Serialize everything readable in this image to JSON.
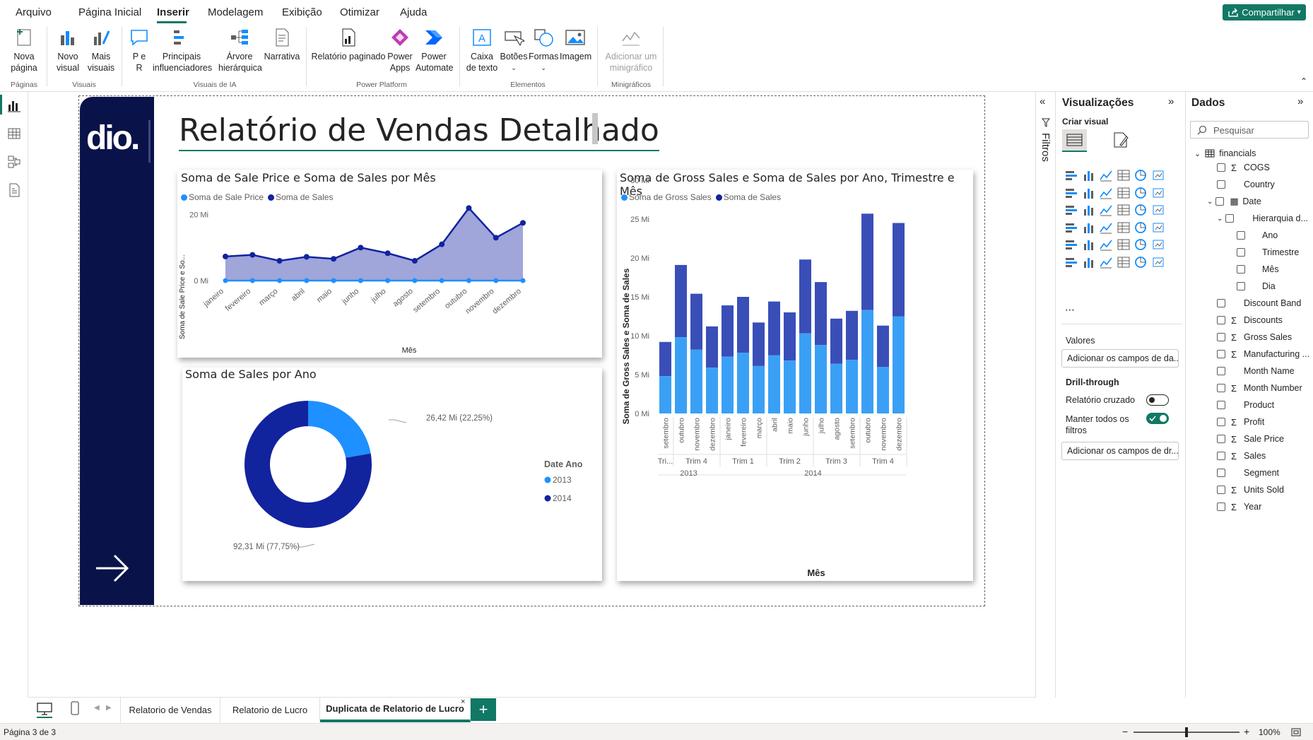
{
  "menu": {
    "items": [
      "Arquivo",
      "Página Inicial",
      "Inserir",
      "Modelagem",
      "Exibição",
      "Otimizar",
      "Ajuda"
    ],
    "active": "Inserir",
    "share_label": "Compartilhar"
  },
  "ribbon": {
    "paginas": {
      "label": "Páginas",
      "new_page": "Nova página"
    },
    "visuais": {
      "label": "Visuais",
      "new_visual": "Novo visual",
      "more_visuals": "Mais visuais"
    },
    "ia": {
      "label": "Visuais de IA",
      "qa": "P e R",
      "key_influencers": "Principais influenciadores",
      "decomp_tree": "Árvore hierárquica",
      "narrative": "Narrativa"
    },
    "power_platform": {
      "label": "Power Platform",
      "paginated": "Relatório paginado",
      "power_apps": "Power Apps",
      "power_automate": "Power Automate"
    },
    "elementos": {
      "label": "Elementos",
      "textbox": "Caixa de texto",
      "buttons": "Botões",
      "shapes": "Formas",
      "image": "Imagem"
    },
    "minigraficos": {
      "label": "Minigráficos",
      "add_sparkline": "Adicionar um minigráfico"
    }
  },
  "report": {
    "title": "Relatório de Vendas Detalhado",
    "logo_text": "dio."
  },
  "charts": {
    "line": {
      "title": "Soma de Sale Price e Soma de Sales por Mês",
      "legend": [
        "Soma de Sale Price",
        "Soma de Sales"
      ],
      "ylabel": "Soma de Sale Price e So...",
      "xlabel": "Mês",
      "yticks": [
        "20 Mi",
        "0 Mi"
      ]
    },
    "donut": {
      "title": "Soma de Sales por Ano",
      "legend_title": "Date Ano",
      "legend": [
        "2013",
        "2014"
      ],
      "label_2013": "26,42 Mi (22,25%)",
      "label_2014": "92,31 Mi (77,75%)"
    },
    "bar": {
      "title": "Soma de Gross Sales e Soma de Sales por Ano, Trimestre e Mês",
      "legend": [
        "Soma de Gross Sales",
        "Soma de Sales"
      ],
      "ylabel": "Soma de Gross Sales e Soma de Sales",
      "xlabel": "Mês",
      "yticks": [
        "30 Mi",
        "25 Mi",
        "20 Mi",
        "15 Mi",
        "10 Mi",
        "5 Mi",
        "0 Mi"
      ]
    }
  },
  "chart_data": [
    {
      "type": "area",
      "title": "Soma de Sale Price e Soma de Sales por Mês",
      "xlabel": "Mês",
      "ylabel": "Soma de Sale Price e So...",
      "categories": [
        "janeiro",
        "fevereiro",
        "março",
        "abril",
        "maio",
        "junho",
        "julho",
        "agosto",
        "setembro",
        "outubro",
        "novembro",
        "dezembro"
      ],
      "ylim": [
        0,
        24
      ],
      "series": [
        {
          "name": "Soma de Sale Price",
          "values": [
            0,
            0,
            0,
            0,
            0,
            0,
            0,
            0,
            0,
            0,
            0,
            0
          ]
        },
        {
          "name": "Soma de Sales",
          "values": [
            7.3,
            7.8,
            6.0,
            7.2,
            6.6,
            10.0,
            8.3,
            6.0,
            11.0,
            22.0,
            13.0,
            17.5
          ]
        }
      ]
    },
    {
      "type": "pie",
      "title": "Soma de Sales por Ano",
      "categories": [
        "2013",
        "2014"
      ],
      "values": [
        26.42,
        92.31
      ],
      "percent": [
        22.25,
        77.75
      ]
    },
    {
      "type": "bar",
      "title": "Soma de Gross Sales e Soma de Sales por Ano, Trimestre e Mês",
      "xlabel": "Mês",
      "ylabel": "Soma de Gross Sales e Soma de Sales",
      "ylim": [
        0,
        30
      ],
      "categories": [
        "setembro",
        "outubro",
        "novembro",
        "dezembro",
        "janeiro",
        "fevereiro",
        "março",
        "abril",
        "maio",
        "junho",
        "julho",
        "agosto",
        "setembro",
        "outubro",
        "novembro",
        "dezembro"
      ],
      "quarters": [
        "Tri...",
        "Trim 4",
        "Trim 1",
        "Trim 2",
        "Trim 3",
        "Trim 4"
      ],
      "years": [
        "2013",
        "2014"
      ],
      "series": [
        {
          "name": "Soma de Sales",
          "values": [
            4.8,
            9.8,
            8.2,
            5.9,
            7.3,
            7.8,
            6.1,
            7.5,
            6.8,
            10.3,
            8.8,
            6.4,
            6.9,
            13.3,
            6.0,
            12.5
          ]
        },
        {
          "name": "Soma de Gross Sales",
          "values": [
            9.2,
            19.1,
            15.4,
            11.2,
            13.9,
            15.0,
            11.7,
            14.4,
            13.0,
            19.8,
            16.9,
            12.2,
            13.2,
            25.7,
            11.3,
            24.5
          ]
        }
      ]
    }
  ],
  "filters_label": "Filtros",
  "visualizations": {
    "title": "Visualizações",
    "create_label": "Criar visual",
    "values_label": "Valores",
    "values_placeholder": "Adicionar os campos de da...",
    "drill_label": "Drill-through",
    "cross_report": "Relatório cruzado",
    "keep_filters": "Manter todos os filtros",
    "drill_placeholder": "Adicionar os campos de dr..."
  },
  "data_pane": {
    "title": "Dados",
    "search_placeholder": "Pesquisar",
    "table": "financials",
    "fields": [
      {
        "name": "COGS",
        "sigma": true,
        "level": 1
      },
      {
        "name": "Country",
        "sigma": false,
        "level": 1
      },
      {
        "name": "Date",
        "sigma": false,
        "level": 1,
        "expandable": true
      },
      {
        "name": "Hierarquia d...",
        "sigma": false,
        "level": 2,
        "expandable": true
      },
      {
        "name": "Ano",
        "sigma": false,
        "level": 3
      },
      {
        "name": "Trimestre",
        "sigma": false,
        "level": 3
      },
      {
        "name": "Mês",
        "sigma": false,
        "level": 3
      },
      {
        "name": "Dia",
        "sigma": false,
        "level": 3
      },
      {
        "name": "Discount Band",
        "sigma": false,
        "level": 1
      },
      {
        "name": "Discounts",
        "sigma": true,
        "level": 1
      },
      {
        "name": "Gross Sales",
        "sigma": true,
        "level": 1
      },
      {
        "name": "Manufacturing ...",
        "sigma": true,
        "level": 1
      },
      {
        "name": "Month Name",
        "sigma": false,
        "level": 1
      },
      {
        "name": "Month Number",
        "sigma": true,
        "level": 1
      },
      {
        "name": "Product",
        "sigma": false,
        "level": 1
      },
      {
        "name": "Profit",
        "sigma": true,
        "level": 1
      },
      {
        "name": "Sale Price",
        "sigma": true,
        "level": 1
      },
      {
        "name": "Sales",
        "sigma": true,
        "level": 1
      },
      {
        "name": "Segment",
        "sigma": false,
        "level": 1
      },
      {
        "name": "Units Sold",
        "sigma": true,
        "level": 1
      },
      {
        "name": "Year",
        "sigma": true,
        "level": 1
      }
    ]
  },
  "tabs": {
    "items": [
      "Relatorio de Vendas",
      "Relatorio de Lucro",
      "Duplicata de Relatorio de Lucro"
    ],
    "active_index": 2
  },
  "status": {
    "page": "Página 3 de 3",
    "zoom": "100%",
    "zoom_fraction": 0.5
  },
  "colors": {
    "accent": "#117865",
    "navy": "#0a1349",
    "series_light": "#1e90ff",
    "series_dark": "#12239e",
    "area_fill": "#8f95d3"
  }
}
